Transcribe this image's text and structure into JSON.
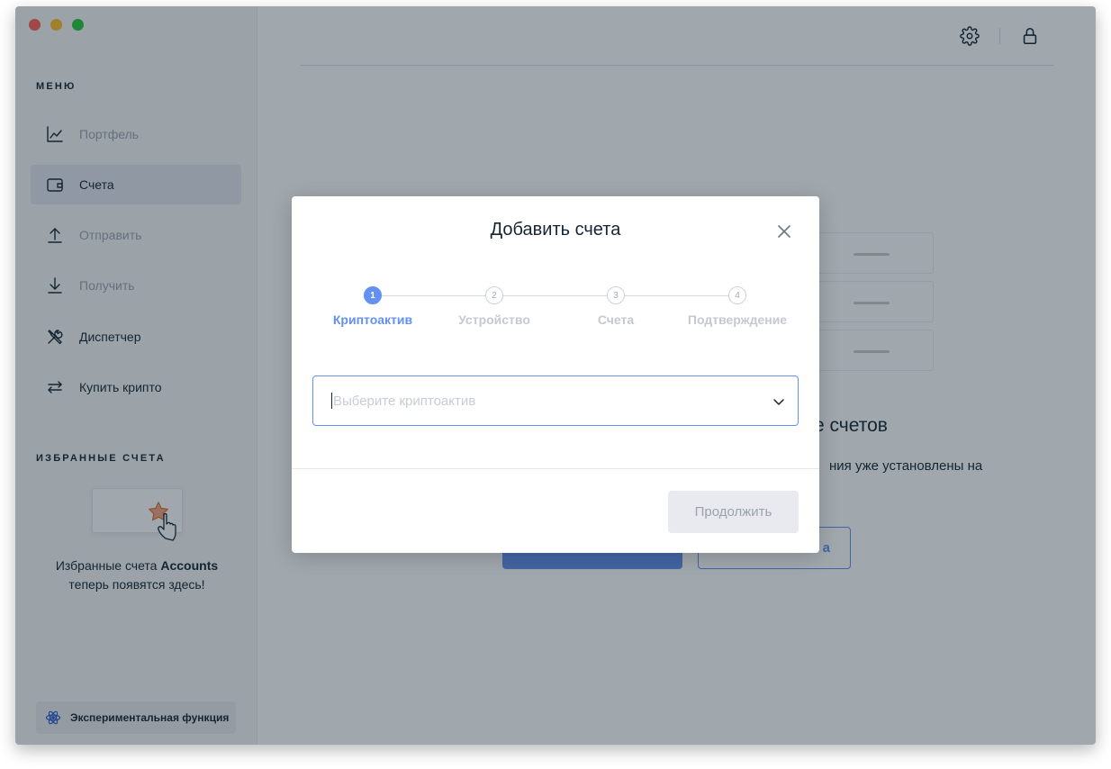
{
  "window_controls": {
    "close": "close",
    "minimize": "minimize",
    "zoom": "zoom"
  },
  "sidebar": {
    "menu_title": "МЕНЮ",
    "items": [
      {
        "label": "Портфель",
        "icon": "chart-line-icon"
      },
      {
        "label": "Счета",
        "icon": "wallet-icon"
      },
      {
        "label": "Отправить",
        "icon": "arrow-up-icon"
      },
      {
        "label": "Получить",
        "icon": "arrow-down-icon"
      },
      {
        "label": "Диспетчер",
        "icon": "tools-icon"
      },
      {
        "label": "Купить крипто",
        "icon": "exchange-icon"
      }
    ],
    "favorites_title": "ИЗБРАННЫЕ СЧЕТА",
    "favorites_text_prefix": "Избранные счета ",
    "favorites_text_bold": "Accounts",
    "favorites_text_suffix": "теперь появятся здесь!",
    "experimental_label": "Экспериментальная функция"
  },
  "topbar": {
    "settings_icon": "gear-icon",
    "lock_icon": "lock-icon"
  },
  "background": {
    "heading_partial": "е счетов",
    "text_partial": "ния уже установлены на",
    "outline_button_partial": "а"
  },
  "modal": {
    "title": "Добавить счета",
    "close_icon": "close-icon",
    "steps": [
      {
        "number": "1",
        "label": "Криптоактив",
        "active": true
      },
      {
        "number": "2",
        "label": "Устройство",
        "active": false
      },
      {
        "number": "3",
        "label": "Счета",
        "active": false
      },
      {
        "number": "4",
        "label": "Подтверждение",
        "active": false
      }
    ],
    "select_placeholder": "Выберите криптоактив",
    "continue_label": "Продолжить"
  },
  "colors": {
    "accent": "#6490f1",
    "text": "#142533",
    "muted": "#9ba4ad",
    "sidebar_bg": "#f5f5f7",
    "active_item_bg": "#e3e6ef"
  }
}
